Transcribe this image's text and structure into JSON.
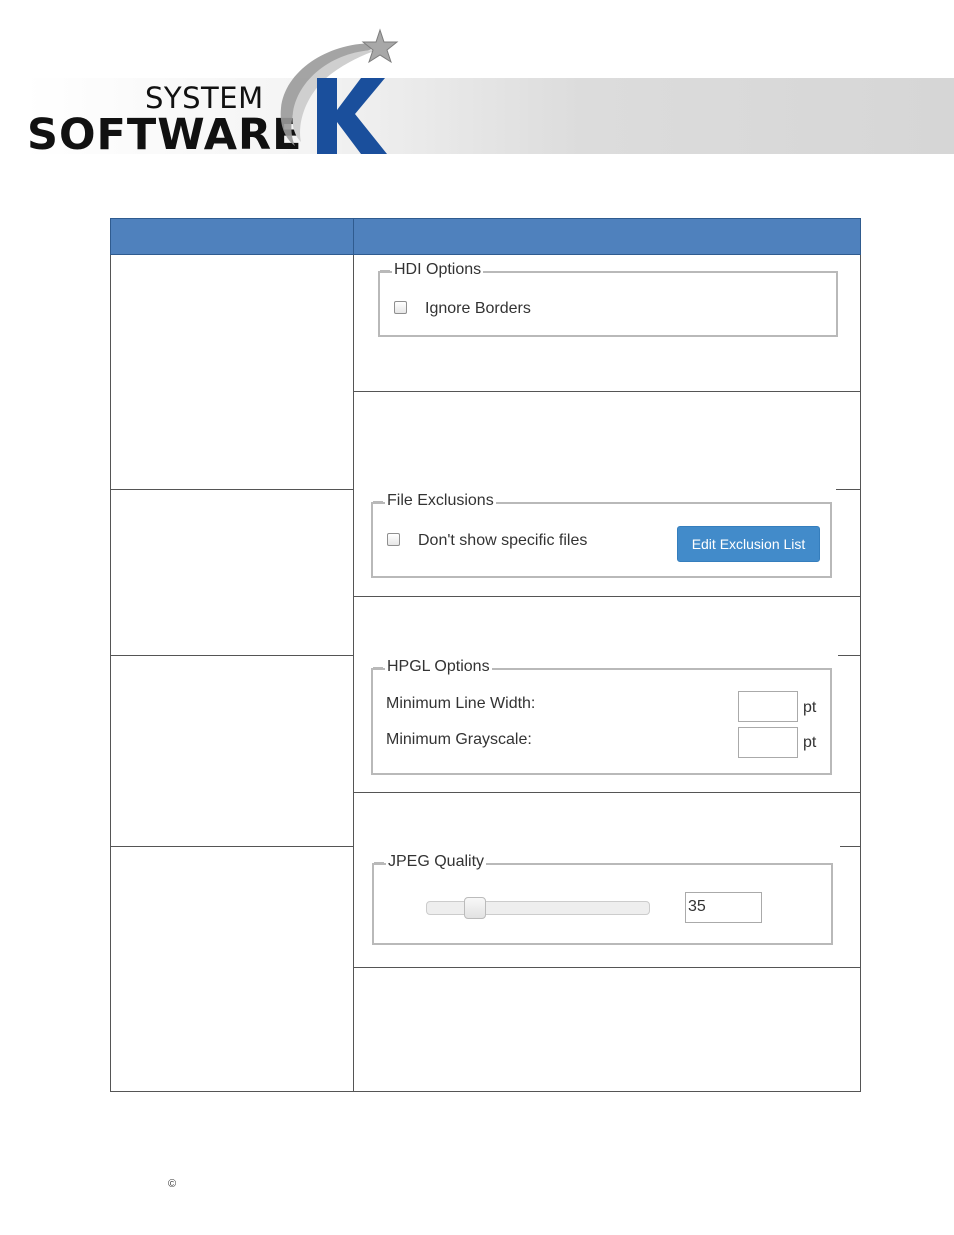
{
  "logo": {
    "line1": "SYSTEM",
    "line2": "SOFTWARE",
    "letter": "K"
  },
  "panels": {
    "hdi": {
      "legend": "HDI Options",
      "checkbox_label": "Ignore Borders",
      "checked": false
    },
    "file_exclusions": {
      "legend": "File Exclusions",
      "checkbox_label": "Don't show specific files",
      "checked": false,
      "button_label": "Edit Exclusion List"
    },
    "hpgl": {
      "legend": "HPGL Options",
      "min_line_width_label": "Minimum Line Width:",
      "min_line_width_value": "",
      "min_line_width_unit": "pt",
      "min_grayscale_label": "Minimum Grayscale:",
      "min_grayscale_value": "",
      "min_grayscale_unit": "pt"
    },
    "jpeg": {
      "legend": "JPEG Quality",
      "quality_value": "35",
      "slider_fraction": 0.19
    }
  },
  "colors": {
    "header_blue": "#4f81bd",
    "button_blue": "#428bca",
    "logo_blue": "#1a4f9c"
  },
  "footer": {
    "copyright_symbol": "©"
  }
}
